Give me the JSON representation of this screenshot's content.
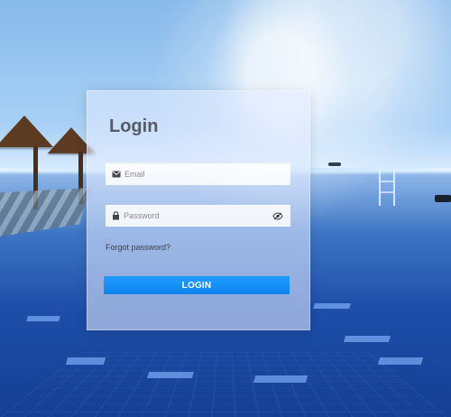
{
  "login": {
    "title": "Login",
    "email_placeholder": "Email",
    "password_placeholder": "Password",
    "forgot_password": "Forgot password?",
    "button_label": "LOGIN"
  },
  "icons": {
    "email": "envelope-icon",
    "password": "lock-icon",
    "password_toggle": "eye-slash-icon"
  },
  "colors": {
    "button": "#1697fb",
    "title": "#555b66"
  }
}
